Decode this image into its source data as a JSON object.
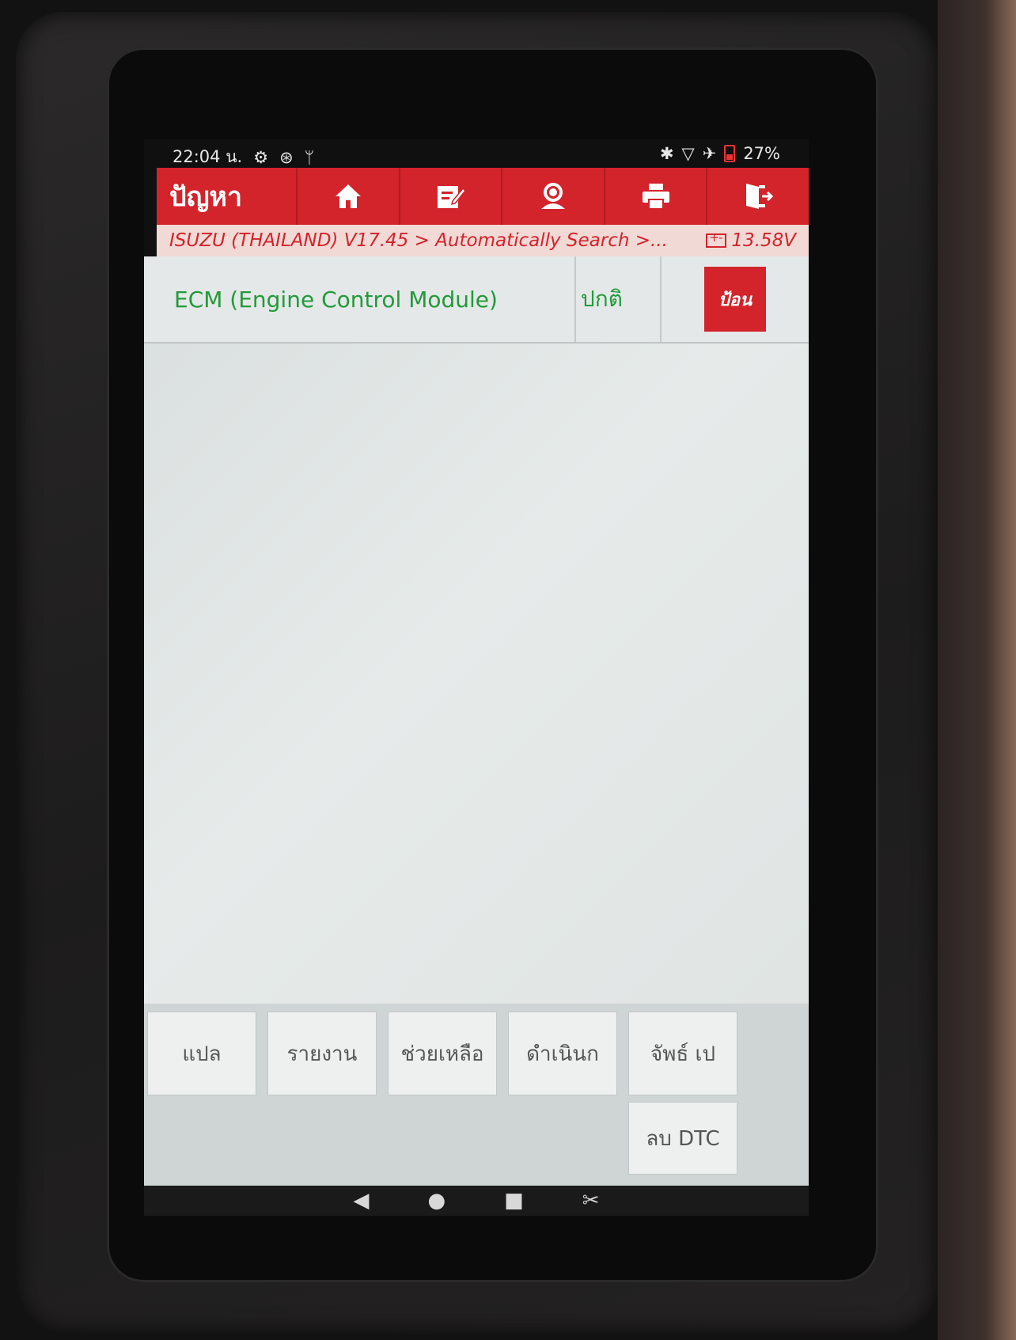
{
  "status_bar": {
    "time": "22:04 น.",
    "battery": "27%"
  },
  "header": {
    "title": "ปัญหา",
    "icons": [
      "home-icon",
      "edit-icon",
      "support-agent-icon",
      "print-icon",
      "exit-icon"
    ]
  },
  "breadcrumb": {
    "path": "ISUZU (THAILAND) V17.45 > Automatically Search >...",
    "voltage": "13.58V"
  },
  "module": {
    "name": "ECM (Engine Control Module)",
    "status": "ปกติ",
    "enter_label": "ป้อน"
  },
  "toolbar": {
    "translate": "แปล",
    "report": "รายงาน",
    "help": "ช่วยเหลือ",
    "proceed": "ดำเนินก",
    "save": "จัพธ์  เป",
    "clear_dtc": "ลบ DTC"
  },
  "colors": {
    "accent_red": "#d3232b",
    "status_green": "#229a3a"
  }
}
